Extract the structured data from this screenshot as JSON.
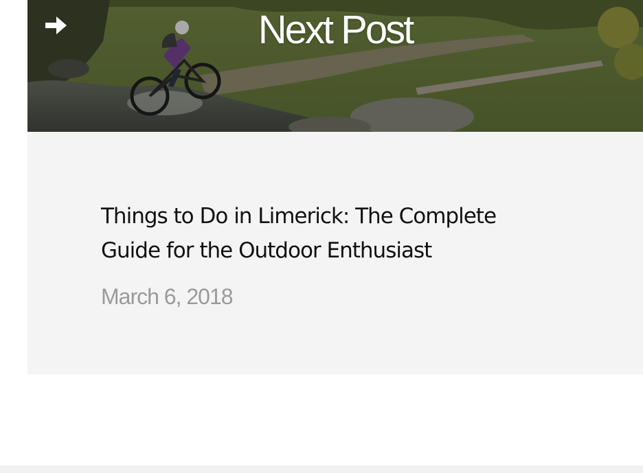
{
  "next_post": {
    "label": "Next Post",
    "arrow_icon": "arrow-right-icon",
    "image_subject": "mountain-biker-crossing-stream"
  },
  "post": {
    "title": "Things to Do in Limerick: The Complete Guide for the Outdoor Enthusiast",
    "date": "March 6, 2018"
  },
  "colors": {
    "card_background": "#f4f4f4",
    "title_text": "#111111",
    "date_text": "#9a9a9a",
    "banner_text": "#ffffff"
  }
}
